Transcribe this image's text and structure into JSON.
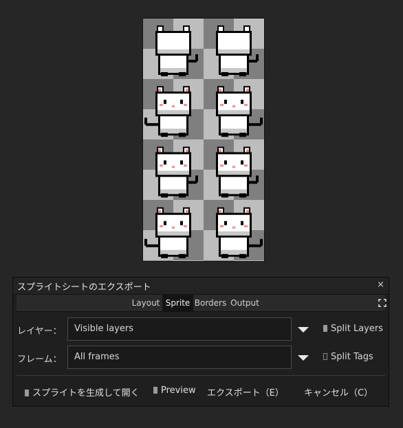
{
  "dialog": {
    "title": "スプライトシートのエクスポート",
    "close_glyph": "×",
    "tabs": [
      "Layout",
      "Sprite",
      "Borders",
      "Output"
    ],
    "active_tab": "Sprite",
    "layers_label": "レイヤー：",
    "layers_value": "Visible layers",
    "split_layers_label": "Split Layers",
    "split_layers_checked": true,
    "frames_label": "フレーム：",
    "frames_value": "All frames",
    "split_tags_label": "Split Tags",
    "split_tags_checked": false,
    "generate_open_label": "スプライトを生成して開く",
    "generate_open_checked": true,
    "preview_label": "Preview",
    "preview_checked": true,
    "export_label": "エクスポート（E）",
    "cancel_label": "キャンセル（C）"
  },
  "preview": {
    "columns": 2,
    "rows": 4,
    "colors": {
      "checker_dark": "#7f7f7f",
      "checker_light": "#bdbdbd",
      "outline": "#000000",
      "body": "#ffffff",
      "shade": "#c8c8c8",
      "pink": "#f28b8b"
    }
  }
}
